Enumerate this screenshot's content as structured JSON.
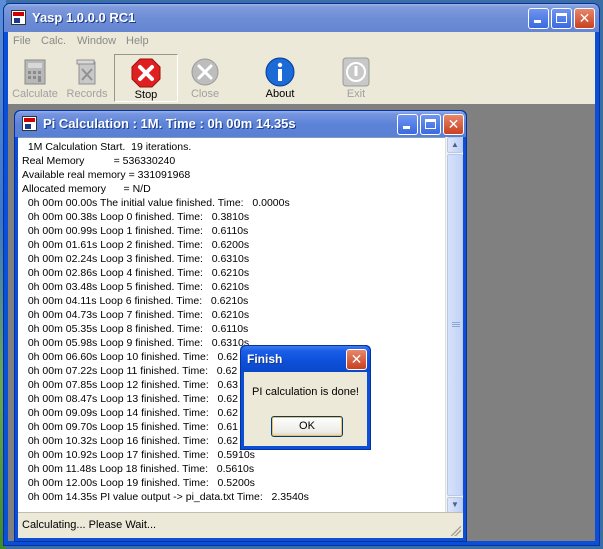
{
  "app": {
    "title": "Yasp 1.0.0.0 RC1"
  },
  "menu": [
    "File",
    "Calc.",
    "Window",
    "Help"
  ],
  "toolbar": {
    "calculate": "Calculate",
    "records": "Records",
    "stop": "Stop",
    "close": "Close",
    "about": "About",
    "exit": "Exit"
  },
  "child": {
    "title": "Pi Calculation : 1M. Time : 0h 00m 14.35s"
  },
  "log": [
    "  1M Calculation Start.  19 iterations.",
    "Real Memory          = 536330240",
    "Available real memory = 331091968",
    "Allocated memory      = N/D",
    "  0h 00m 00.00s The initial value finished. Time:   0.0000s",
    "  0h 00m 00.38s Loop 0 finished. Time:   0.3810s",
    "  0h 00m 00.99s Loop 1 finished. Time:   0.6110s",
    "  0h 00m 01.61s Loop 2 finished. Time:   0.6200s",
    "  0h 00m 02.24s Loop 3 finished. Time:   0.6310s",
    "  0h 00m 02.86s Loop 4 finished. Time:   0.6210s",
    "  0h 00m 03.48s Loop 5 finished. Time:   0.6210s",
    "  0h 00m 04.11s Loop 6 finished. Time:   0.6210s",
    "  0h 00m 04.73s Loop 7 finished. Time:   0.6210s",
    "  0h 00m 05.35s Loop 8 finished. Time:   0.6110s",
    "  0h 00m 05.98s Loop 9 finished. Time:   0.6310s",
    "  0h 00m 06.60s Loop 10 finished. Time:   0.62",
    "  0h 00m 07.22s Loop 11 finished. Time:   0.62",
    "  0h 00m 07.85s Loop 12 finished. Time:   0.63",
    "  0h 00m 08.47s Loop 13 finished. Time:   0.62",
    "  0h 00m 09.09s Loop 14 finished. Time:   0.62",
    "  0h 00m 09.70s Loop 15 finished. Time:   0.61",
    "  0h 00m 10.32s Loop 16 finished. Time:   0.62",
    "  0h 00m 10.92s Loop 17 finished. Time:   0.5910s",
    "  0h 00m 11.48s Loop 18 finished. Time:   0.5610s",
    "  0h 00m 12.00s Loop 19 finished. Time:   0.5200s",
    "  0h 00m 14.35s PI value output -> pi_data.txt Time:   2.3540s"
  ],
  "status": "Calculating... Please Wait...",
  "dialog": {
    "title": "Finish",
    "message": "PI calculation is done!",
    "ok": "OK"
  },
  "icons": {
    "app": "app-icon",
    "calculate": "calculate-icon",
    "records": "records-icon",
    "stop": "stop-icon",
    "close": "close-x-icon",
    "about": "info-icon",
    "exit": "exit-icon"
  },
  "colors": {
    "stop": "#e02020",
    "about": "#1a6ad8",
    "disabled": "#a0a0a0"
  }
}
